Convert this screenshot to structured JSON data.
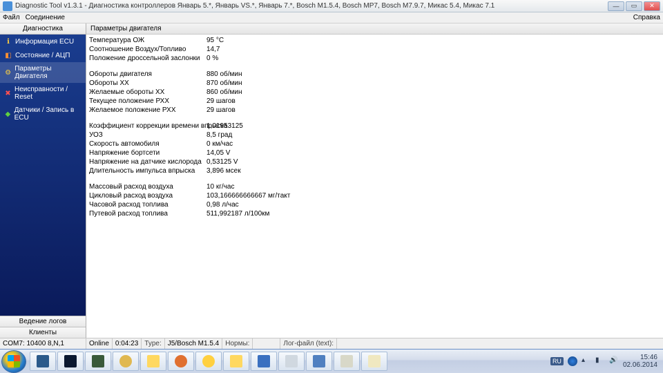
{
  "window": {
    "title": "Diagnostic Tool v1.3.1 - Диагностика контроллеров Январь 5.*, Январь VS.*, Январь 7.*, Bosch M1.5.4, Bosch MP7, Bosch M7.9.7, Микас 5.4, Микас 7.1"
  },
  "menu": {
    "file": "Файл",
    "connection": "Соединение",
    "help": "Справка"
  },
  "sidebar": {
    "header": "Диагностика",
    "items": [
      {
        "label": "Информация ECU",
        "icon": "ℹ",
        "iconClass": "icon-yellow"
      },
      {
        "label": "Состояние / АЦП",
        "icon": "◧",
        "iconClass": "icon-orange"
      },
      {
        "label": "Параметры Двигателя",
        "icon": "⚙",
        "iconClass": "icon-yellow",
        "active": true
      },
      {
        "label": "Неисправности / Reset",
        "icon": "✖",
        "iconClass": "icon-red"
      },
      {
        "label": "Датчики / Запись в ECU",
        "icon": "◆",
        "iconClass": "icon-green"
      }
    ],
    "bottom": [
      {
        "label": "Ведение логов"
      },
      {
        "label": "Клиенты"
      }
    ]
  },
  "content": {
    "title": "Параметры двигателя",
    "params": [
      {
        "label": "Температура ОЖ",
        "value": "95 °C"
      },
      {
        "label": "Соотношение Воздух/Топливо",
        "value": "14,7"
      },
      {
        "label": "Положение дроссельной заслонки",
        "value": "0 %"
      },
      {
        "spacer": true
      },
      {
        "label": "Обороты двигателя",
        "value": "880 об/мин"
      },
      {
        "label": "Обороты ХХ",
        "value": "870 об/мин"
      },
      {
        "label": "Желаемые обороты ХХ",
        "value": "860 об/мин"
      },
      {
        "label": "Текущее положение РХХ",
        "value": "29 шагов"
      },
      {
        "label": "Желаемое положение РХХ",
        "value": "29 шагов"
      },
      {
        "spacer": true
      },
      {
        "label": "Коэффициент коррекции времени впрыска",
        "value": "1,01953125"
      },
      {
        "label": "УОЗ",
        "value": "8,5 град"
      },
      {
        "label": "Скорость автомобиля",
        "value": "0 км/час"
      },
      {
        "label": "Напряжение бортсети",
        "value": "14,05 V"
      },
      {
        "label": "Напряжение на датчике кислорода",
        "value": "0,53125 V"
      },
      {
        "label": "Длительность импульса впрыска",
        "value": "3,896 мсек"
      },
      {
        "spacer": true
      },
      {
        "label": "Массовый расход воздуха",
        "value": "10 кг/час"
      },
      {
        "label": "Цикловый расход воздуха",
        "value": "103,166666666667 мг/такт"
      },
      {
        "label": "Часовой расход топлива",
        "value": "0,98 л/час"
      },
      {
        "label": "Путевой расход топлива",
        "value": "511,992187 л/100км"
      }
    ]
  },
  "status": {
    "com": "COM7: 10400 8,N,1",
    "online": "Online",
    "time": "0:04:23",
    "type_label": "Type:",
    "type": "J5/Bosch M1.5.4",
    "norms_label": "Нормы:",
    "norms": "",
    "log_label": "Лог-файл (text):"
  },
  "taskbar": {
    "items": [
      {
        "color": "#2b5a8a"
      },
      {
        "color": "#0a1830"
      },
      {
        "color": "#3a5a3a"
      },
      {
        "color": "#e0b850",
        "round": true
      },
      {
        "color": "#ffd860"
      },
      {
        "color": "#e07030",
        "round": true
      },
      {
        "color": "#ffd040",
        "round": true
      },
      {
        "color": "#ffd860"
      },
      {
        "color": "#3a70c0"
      },
      {
        "color": "#d0d8e0"
      },
      {
        "color": "#5080c0"
      },
      {
        "color": "#d8d8c8"
      },
      {
        "color": "#f0e8c0"
      }
    ],
    "lang": "RU",
    "clock": {
      "time": "15:46",
      "date": "02.06.2014"
    }
  }
}
